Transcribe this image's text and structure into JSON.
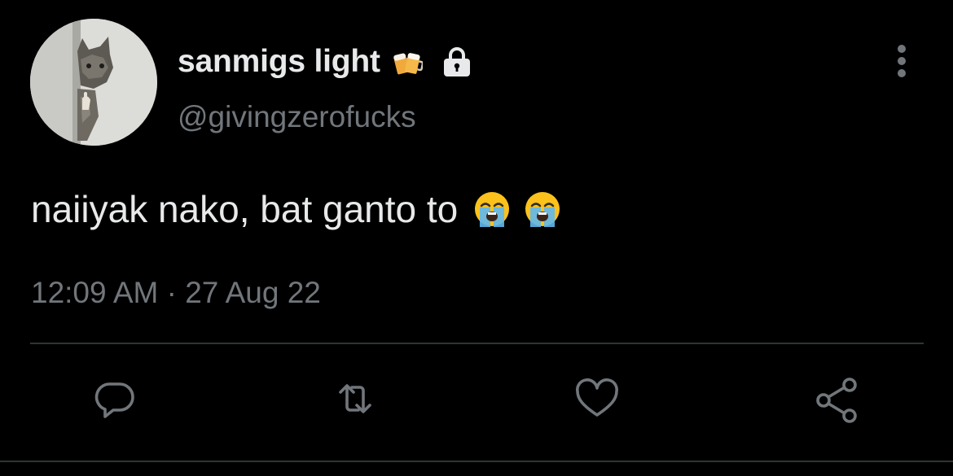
{
  "user": {
    "display_name": "sanmigs light",
    "name_emoji": "beer-mugs-icon",
    "protected_icon": "lock-icon",
    "handle": "@givingzerofucks"
  },
  "tweet": {
    "text": "naiiyak nako, bat ganto to",
    "trailing_emoji": [
      "crying-face-icon",
      "crying-face-icon"
    ],
    "timestamp": "12:09 AM · 27 Aug 22"
  },
  "actions": [
    "reply-icon",
    "retweet-icon",
    "like-icon",
    "share-icon"
  ],
  "colors": {
    "background": "#000000",
    "primary_text": "#e7e9ea",
    "secondary_text": "#71767b",
    "divider": "#2f3336"
  }
}
